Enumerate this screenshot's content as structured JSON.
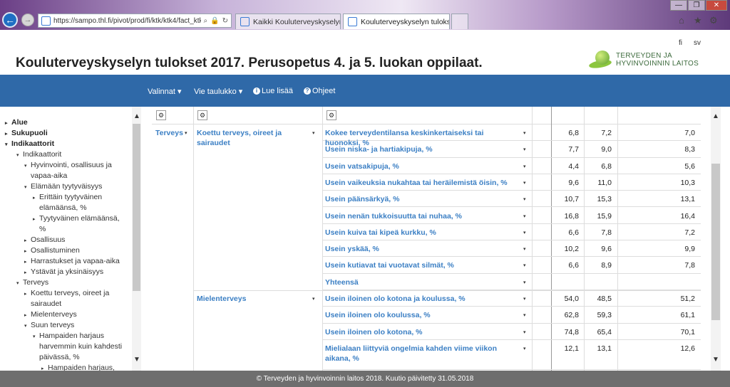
{
  "browser": {
    "url": "https://sampo.thl.fi/pivot/prod/fi/ktk/ktk4/fact_ktk",
    "tabs": [
      {
        "label": "Kaikki Kouluterveyskyselyn tul..."
      },
      {
        "label": "Kouluterveyskyselyn tuloks...",
        "close": "✕"
      }
    ],
    "window": {
      "min": "—",
      "max": "❐",
      "close": "✕"
    }
  },
  "header": {
    "lang_fi": "fi",
    "lang_sv": "sv",
    "title": "Kouluterveyskyselyn tulokset 2017. Perusopetus 4. ja 5. luokan oppilaat.",
    "logo_line1": "TERVEYDEN JA",
    "logo_line2": "HYVINVOINNIN LAITOS"
  },
  "nav": {
    "valinnat": "Valinnat ▾",
    "vie_taulukko": "Vie taulukko ▾",
    "lue_lisaa": "Lue lisää",
    "ohjeet": "Ohjeet"
  },
  "sidebar": {
    "items": [
      {
        "label": "Alue",
        "tri": "▸",
        "bold": true
      },
      {
        "label": "Sukupuoli",
        "tri": "▸",
        "bold": true
      },
      {
        "label": "Indikaattorit",
        "tri": "▾",
        "bold": true
      },
      {
        "label": "Indikaattorit",
        "tri": "▾",
        "bold": false
      },
      {
        "label": "Hyvinvointi, osallisuus ja",
        "tri": "▾",
        "bold": false
      },
      {
        "label": "vapaa-aika",
        "tri": "",
        "bold": false
      },
      {
        "label": "Elämään tyytyväisyys",
        "tri": "▾",
        "bold": false
      },
      {
        "label": "Erittäin tyytyväinen",
        "tri": "▸",
        "bold": false
      },
      {
        "label": "elämäänsä, %",
        "tri": "",
        "bold": false
      },
      {
        "label": "Tyytyväinen elämäänsä,",
        "tri": "▸",
        "bold": false
      },
      {
        "label": "%",
        "tri": "",
        "bold": false
      },
      {
        "label": "Osallisuus",
        "tri": "▸",
        "bold": false
      },
      {
        "label": "Osallistuminen",
        "tri": "▸",
        "bold": false
      },
      {
        "label": "Harrastukset ja vapaa-aika",
        "tri": "▸",
        "bold": false
      },
      {
        "label": "Ystävät ja yksinäisyys",
        "tri": "▸",
        "bold": false
      },
      {
        "label": "Terveys",
        "tri": "▾",
        "bold": false
      },
      {
        "label": "Koettu terveys, oireet ja",
        "tri": "▸",
        "bold": false
      },
      {
        "label": "sairaudet",
        "tri": "",
        "bold": false
      },
      {
        "label": "Mielenterveys",
        "tri": "▸",
        "bold": false
      },
      {
        "label": "Suun terveys",
        "tri": "▾",
        "bold": false
      },
      {
        "label": "Hampaiden harjaus",
        "tri": "▾",
        "bold": false
      },
      {
        "label": "harvemmin kuin kahdesti",
        "tri": "",
        "bold": false
      },
      {
        "label": "päivässä, %",
        "tri": "",
        "bold": false
      },
      {
        "label": "Hampaiden harjaus,",
        "tri": "▸",
        "bold": false
      }
    ],
    "scroll_up": "▲",
    "scroll_down": "▼"
  },
  "table": {
    "gear": "⚙",
    "caret": "▾",
    "col1": "Terveys",
    "group1": "Koettu terveys, oireet ja sairaudet",
    "group2": "Mielenterveys",
    "rows": [
      {
        "label": "Kokee terveydentilansa keskinkertaiseksi tai huonoksi, %",
        "v1": "6,8",
        "v2": "7,2",
        "v3": "7,0"
      },
      {
        "label": "Usein niska- ja hartiakipuja, %",
        "v1": "7,7",
        "v2": "9,0",
        "v3": "8,3"
      },
      {
        "label": "Usein vatsakipuja, %",
        "v1": "4,4",
        "v2": "6,8",
        "v3": "5,6"
      },
      {
        "label": "Usein vaikeuksia nukahtaa tai heräilemistä öisin, %",
        "v1": "9,6",
        "v2": "11,0",
        "v3": "10,3"
      },
      {
        "label": "Usein päänsärkyä, %",
        "v1": "10,7",
        "v2": "15,3",
        "v3": "13,1"
      },
      {
        "label": "Usein nenän tukkoisuutta tai nuhaa, %",
        "v1": "16,8",
        "v2": "15,9",
        "v3": "16,4"
      },
      {
        "label": "Usein kuiva tai kipeä kurkku, %",
        "v1": "6,6",
        "v2": "7,8",
        "v3": "7,2"
      },
      {
        "label": "Usein yskää, %",
        "v1": "10,2",
        "v2": "9,6",
        "v3": "9,9"
      },
      {
        "label": "Usein kutiavat tai vuotavat silmät, %",
        "v1": "6,6",
        "v2": "8,9",
        "v3": "7,8"
      },
      {
        "label": "Yhteensä",
        "v1": "",
        "v2": "",
        "v3": ""
      },
      {
        "label": "Usein iloinen olo kotona ja koulussa, %",
        "v1": "54,0",
        "v2": "48,5",
        "v3": "51,2"
      },
      {
        "label": "Usein iloinen olo koulussa, %",
        "v1": "62,8",
        "v2": "59,3",
        "v3": "61,1"
      },
      {
        "label": "Usein iloinen olo kotona, %",
        "v1": "74,8",
        "v2": "65,4",
        "v3": "70,1"
      },
      {
        "label": "Mielialaan liittyviä ongelmia kahden viime viikon aikana, %",
        "v1": "12,1",
        "v2": "13,1",
        "v3": "12,6"
      }
    ],
    "scroll_up": "▲",
    "scroll_down": "▼"
  },
  "footer": {
    "text": "© Terveyden ja hyvinvoinnin laitos 2018. Kuutio päivitetty 31.05.2018"
  }
}
